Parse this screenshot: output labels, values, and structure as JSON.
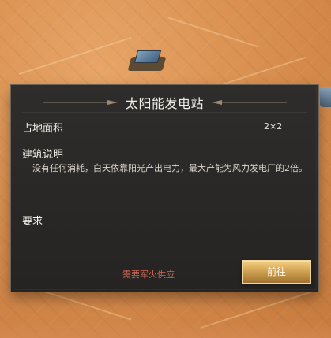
{
  "dialog": {
    "title": "太阳能发电站",
    "area_label": "占地面积",
    "area_value": "2×2",
    "description_label": "建筑说明",
    "description_text": "没有任何消耗，白天依靠阳光产出电力，最大产能为风力发电厂的2倍。",
    "requirement_label": "要求",
    "supply_note": "需要军火供应",
    "go_button": "前往"
  },
  "colors": {
    "background_sand": "#d98f4f",
    "panel_bg": "#2a2826",
    "accent_gold": "#d3a453",
    "warning_red": "#d46a55"
  },
  "icons": {
    "title_ornament_left": "title-ornament-left-icon",
    "title_ornament_right": "title-ornament-right-icon"
  }
}
